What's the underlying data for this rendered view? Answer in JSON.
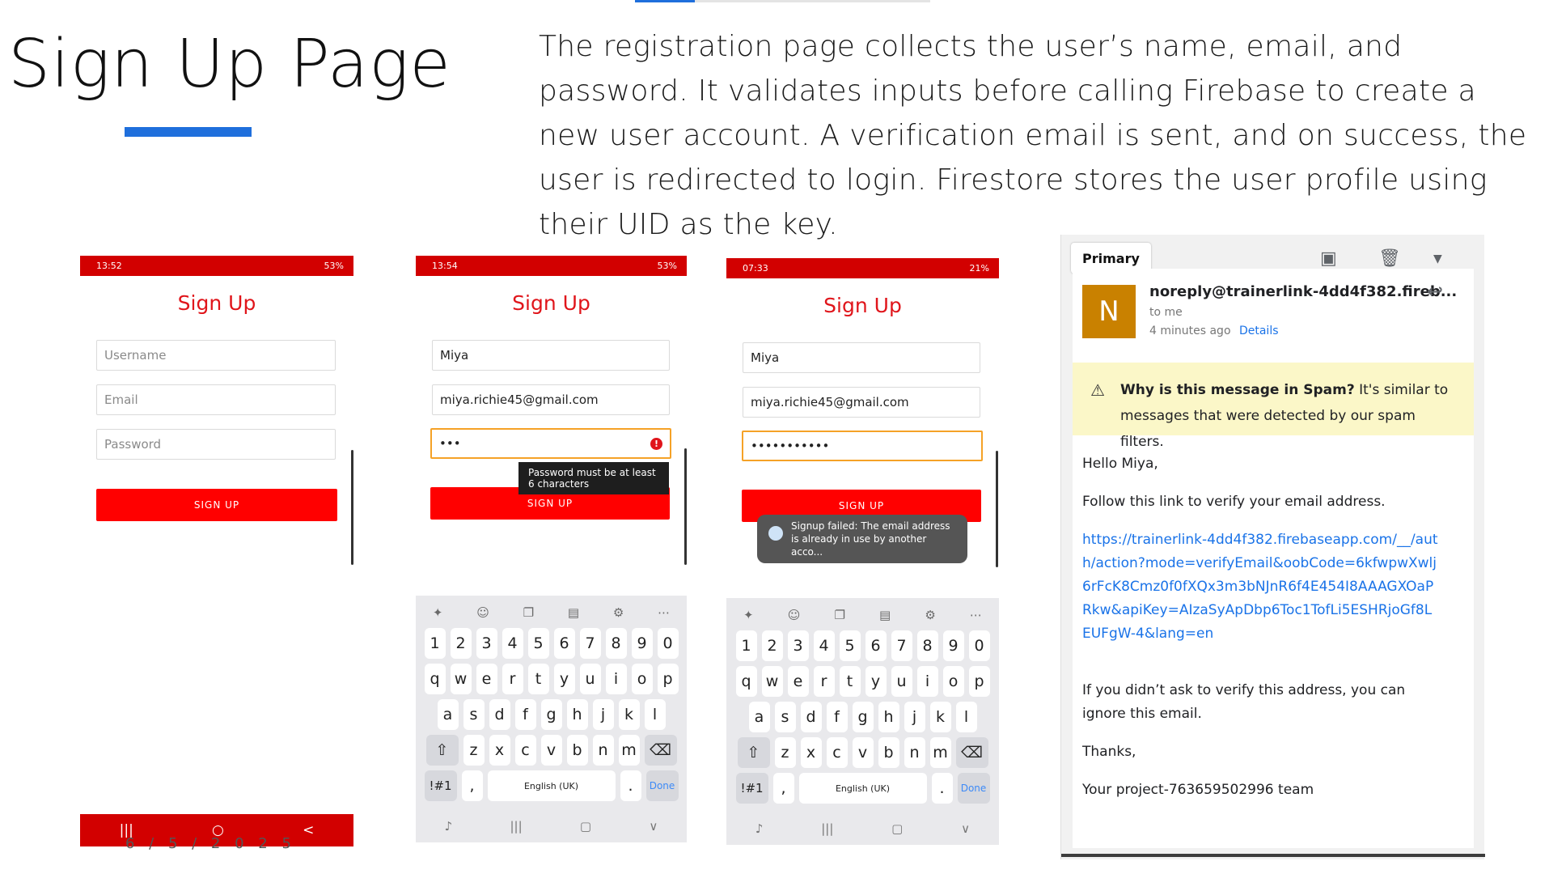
{
  "slide": {
    "title": "Sign Up Page",
    "description": "The registration page collects the user’s name, email, and password. It validates inputs before calling Firebase to create a new user account. A verification email is sent, and on success, the user is redirected to login. Firestore stores the user profile using their UID as the key.",
    "date": "6 / 5 / 2 0 2 5"
  },
  "colors": {
    "accent_blue": "#1f6fdc",
    "app_red": "#d20000",
    "button_red": "#ff0000"
  },
  "phone1": {
    "status_time": "13:52",
    "status_right": "53%",
    "title": "Sign Up",
    "username_placeholder": "Username",
    "email_placeholder": "Email",
    "password_placeholder": "Password",
    "button_label": "SIGN UP",
    "nav": {
      "recent_icon": "|||",
      "home_icon": "○",
      "back_icon": "<"
    }
  },
  "phone2": {
    "status_time": "13:54",
    "status_right": "53%",
    "title": "Sign Up",
    "username_value": "Miya",
    "email_value": "miya.richie45@gmail.com",
    "password_value": "•••",
    "error_tooltip": "Password must be at least 6 characters",
    "button_label": "SIGN UP"
  },
  "phone3": {
    "status_time": "07:33",
    "status_right": "21%",
    "title": "Sign Up",
    "username_value": "Miya",
    "email_value": "miya.richie45@gmail.com",
    "password_value": "•••••••••••",
    "button_label": "SIGN UP",
    "toast": "Signup failed: The email address is already in use by another acco..."
  },
  "keyboard": {
    "numbers": [
      "1",
      "2",
      "3",
      "4",
      "5",
      "6",
      "7",
      "8",
      "9",
      "0"
    ],
    "row1": [
      "q",
      "w",
      "e",
      "r",
      "t",
      "y",
      "u",
      "i",
      "o",
      "p"
    ],
    "row2": [
      "a",
      "s",
      "d",
      "f",
      "g",
      "h",
      "j",
      "k",
      "l"
    ],
    "row3": [
      "z",
      "x",
      "c",
      "v",
      "b",
      "n",
      "m"
    ],
    "symbols_key": "!#1",
    "comma_key": ",",
    "space_label": "English (UK)",
    "period_key": ".",
    "done_label": "Done"
  },
  "email": {
    "label": "Primary",
    "avatar_letter": "N",
    "sender": "noreply@trainerlink-4dd4f382.fireb...",
    "to": "to me",
    "time": "4 minutes ago",
    "details_link": "Details",
    "spam_title": "Why is this message in Spam?",
    "spam_text": "It's similar to messages that were detected by our spam filters.",
    "greeting": "Hello Miya,",
    "instruction": "Follow this link to verify your email address.",
    "link": "https://trainerlink-4dd4f382.firebaseapp.com/__/auth/action?mode=verifyEmail&oobCode=6kfwpwXwlj6rFcK8Cmz0f0fXQx3m3bNJnR6f4E454I8AAAGXOaPRkw&apiKey=AIzaSyApDbp6Toc1TofLi5ESHRjoGf8LEUFgW-4&lang=en",
    "ignore_text": "If you didn’t ask to verify this address, you can ignore this email.",
    "thanks": "Thanks,",
    "signature": "Your project-763659502996 team"
  }
}
